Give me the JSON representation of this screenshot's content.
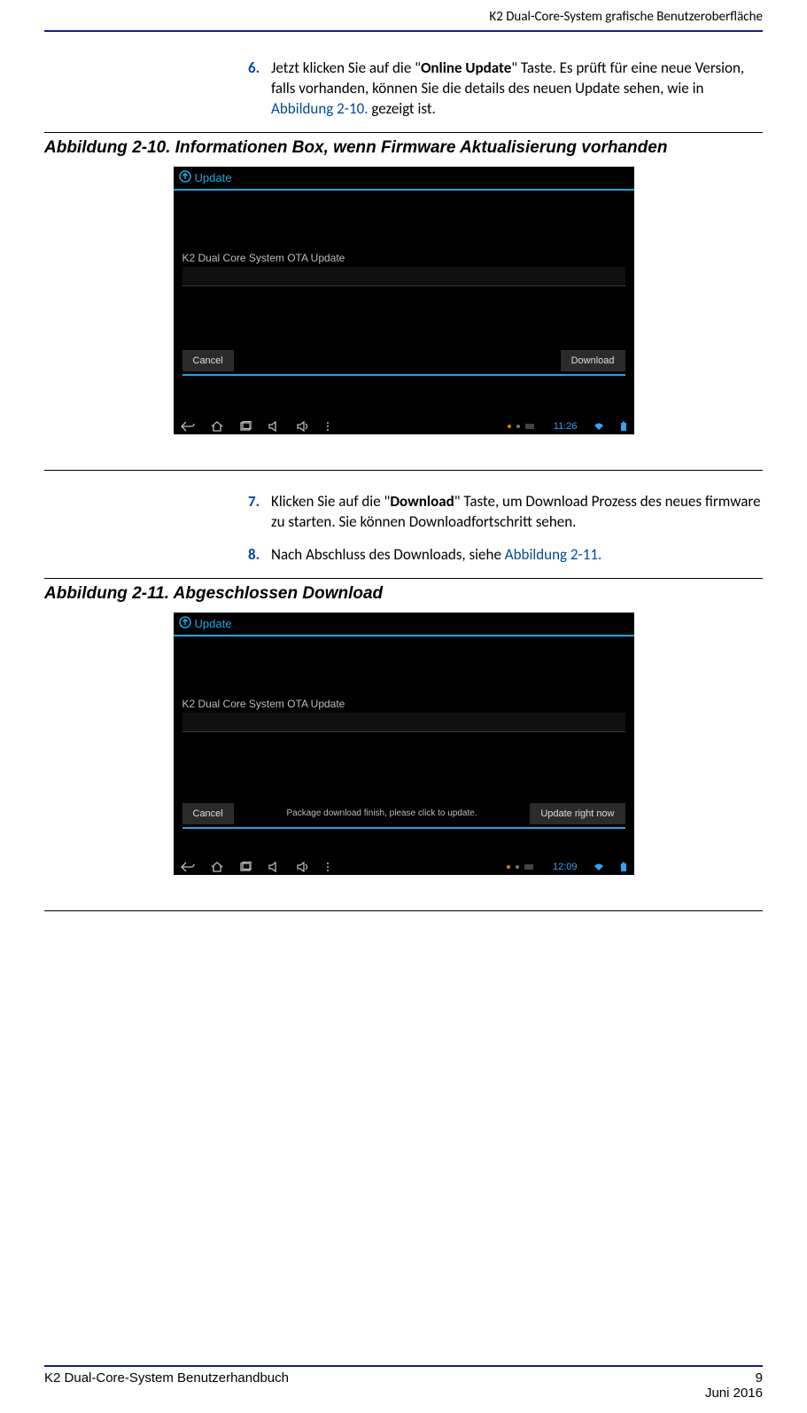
{
  "header": {
    "section_title": "K2 Dual-Core-System grafische Benutzeroberfläche"
  },
  "steps_a": [
    {
      "num": "6.",
      "pre": "Jetzt klicken Sie auf die \"",
      "bold": "Online Update",
      "post": "\" Taste. Es prüft für eine neue Version, falls vorhanden, können Sie die details des neuen Update sehen, wie in ",
      "xref": "Abbildung 2-10.",
      "tail": "  gezeigt ist."
    }
  ],
  "fig_a": {
    "caption": "Abbildung 2-10. Informationen Box, wenn Firmware Aktualisierung vorhanden"
  },
  "shot_a": {
    "title": "Update",
    "line1": "K2 Dual Core System OTA Update",
    "cancel": "Cancel",
    "right_btn": "Download",
    "status": "",
    "time": "11:26"
  },
  "steps_b": [
    {
      "num": "7.",
      "pre": "Klicken Sie auf die \"",
      "bold": "Download",
      "post": "\" Taste, um Download Prozess des neues firmware zu starten. Sie können Downloadfortschritt sehen.",
      "xref": "",
      "tail": ""
    },
    {
      "num": "8.",
      "pre": "Nach Abschluss des Downloads, siehe ",
      "bold": "",
      "post": "",
      "xref": "Abbildung 2-11.",
      "tail": ""
    }
  ],
  "fig_b": {
    "caption": "Abbildung 2-11. Abgeschlossen Download"
  },
  "shot_b": {
    "title": "Update",
    "line1": "K2 Dual Core System OTA Update",
    "cancel": "Cancel",
    "right_btn": "Update right now",
    "status": "Package download finish, please click to update.",
    "time": "12:09"
  },
  "footer": {
    "left": "K2 Dual-Core-System Benutzerhandbuch",
    "page": "9",
    "date": "Juni 2016"
  }
}
